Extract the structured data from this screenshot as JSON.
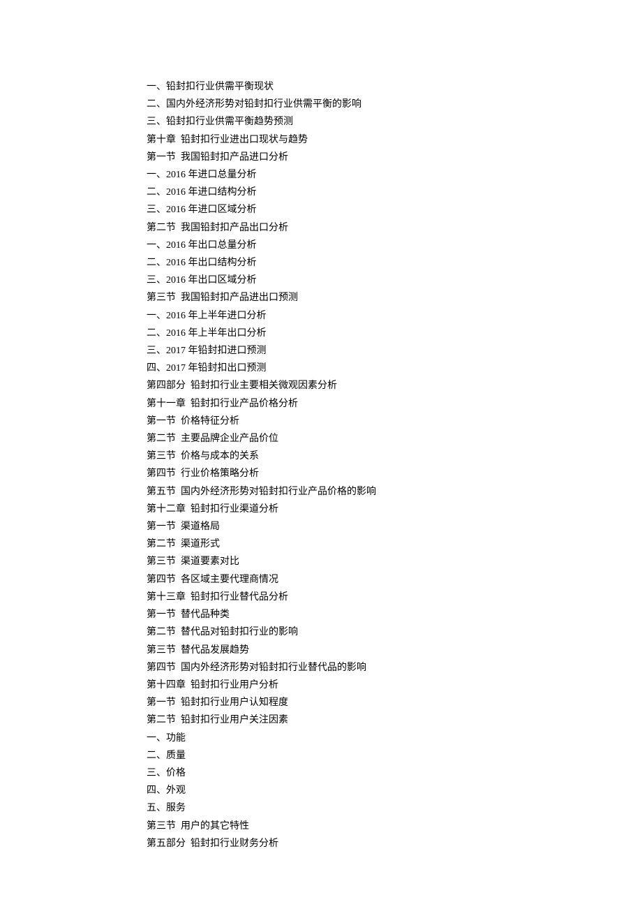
{
  "lines": [
    "一、铅封扣行业供需平衡现状",
    "二、国内外经济形势对铅封扣行业供需平衡的影响",
    "三、铅封扣行业供需平衡趋势预测",
    "第十章  铅封扣行业进出口现状与趋势",
    "第一节  我国铅封扣产品进口分析",
    "一、2016 年进口总量分析",
    "二、2016 年进口结构分析",
    "三、2016 年进口区域分析",
    "第二节  我国铅封扣产品出口分析",
    "一、2016 年出口总量分析",
    "二、2016 年出口结构分析",
    "三、2016 年出口区域分析",
    "第三节  我国铅封扣产品进出口预测",
    "一、2016 年上半年进口分析",
    "二、2016 年上半年出口分析",
    "三、2017 年铅封扣进口预测",
    "四、2017 年铅封扣出口预测",
    "第四部分  铅封扣行业主要相关微观因素分析",
    "第十一章  铅封扣行业产品价格分析",
    "第一节  价格特征分析",
    "第二节  主要品牌企业产品价位",
    "第三节  价格与成本的关系",
    "第四节  行业价格策略分析",
    "第五节  国内外经济形势对铅封扣行业产品价格的影响",
    "第十二章  铅封扣行业渠道分析",
    "第一节  渠道格局",
    "第二节  渠道形式",
    "第三节  渠道要素对比",
    "第四节  各区域主要代理商情况",
    "第十三章  铅封扣行业替代品分析",
    "第一节  替代品种类",
    "第二节  替代品对铅封扣行业的影响",
    "第三节  替代品发展趋势",
    "第四节  国内外经济形势对铅封扣行业替代品的影响",
    "第十四章  铅封扣行业用户分析",
    "第一节  铅封扣行业用户认知程度",
    "第二节  铅封扣行业用户关注因素",
    "一、功能",
    "二、质量",
    "三、价格",
    "四、外观",
    "五、服务",
    "第三节  用户的其它特性",
    "第五部分  铅封扣行业财务分析"
  ]
}
